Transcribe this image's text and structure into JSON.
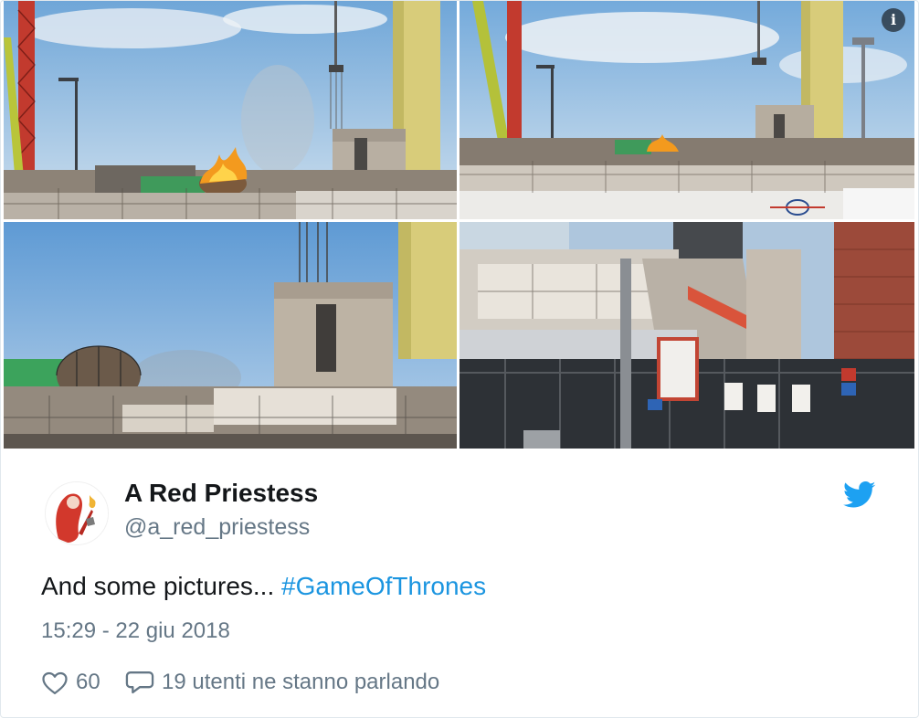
{
  "media": {
    "info_glyph": "i",
    "photos": [
      {
        "name": "photo-1"
      },
      {
        "name": "photo-2"
      },
      {
        "name": "photo-3"
      },
      {
        "name": "photo-4"
      }
    ]
  },
  "author": {
    "display_name": "A Red Priestess",
    "handle": "@a_red_priestess",
    "avatar_icon": "red-priestess-avatar",
    "platform_icon": "twitter-bird-icon"
  },
  "tweet": {
    "text": "And some pictures... ",
    "hashtag": "#GameOfThrones",
    "timestamp": "15:29 - 22 giu 2018"
  },
  "actions": {
    "likes_count": "60",
    "talking_label": "19 utenti ne stanno parlando",
    "like_icon": "heart-outline-icon",
    "reply_icon": "speech-bubble-icon"
  },
  "colors": {
    "link": "#1b95e0",
    "secondary_text": "#657786",
    "primary_text": "#14171a",
    "twitter_blue": "#1da1f2"
  }
}
